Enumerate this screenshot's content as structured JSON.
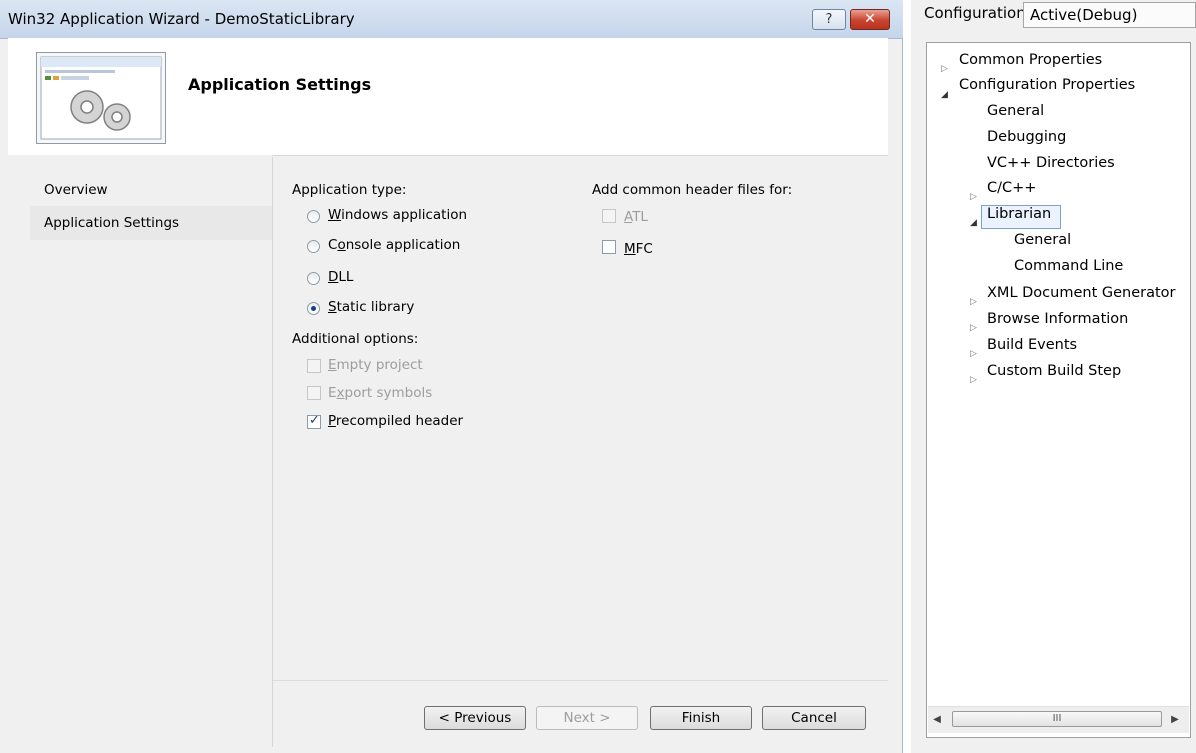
{
  "wizard": {
    "title": "Win32 Application Wizard - DemoStaticLibrary",
    "banner_title": "Application Settings",
    "nav": [
      {
        "label": "Overview"
      },
      {
        "label": "Application Settings"
      }
    ],
    "application_type": {
      "label": "Application type:",
      "options": [
        {
          "text_before": "",
          "mnemonic": "W",
          "text_after": "indows application",
          "selected": false
        },
        {
          "text_before": "C",
          "mnemonic": "o",
          "text_after": "nsole application",
          "selected": false
        },
        {
          "text_before": "",
          "mnemonic": "D",
          "text_after": "LL",
          "selected": false
        },
        {
          "text_before": "",
          "mnemonic": "S",
          "text_after": "tatic library",
          "selected": true
        }
      ]
    },
    "additional_options": {
      "label": "Additional options:",
      "options": [
        {
          "text_before": "",
          "mnemonic": "E",
          "text_after": "mpty project",
          "checked": false,
          "enabled": false
        },
        {
          "text_before": "E",
          "mnemonic": "x",
          "text_after": "port symbols",
          "checked": false,
          "enabled": false
        },
        {
          "text_before": "",
          "mnemonic": "P",
          "text_after": "recompiled header",
          "checked": true,
          "enabled": true
        }
      ]
    },
    "common_headers": {
      "label": "Add common header files for:",
      "options": [
        {
          "text_before": "",
          "mnemonic": "A",
          "text_after": "TL",
          "checked": false,
          "enabled": false
        },
        {
          "text_before": "",
          "mnemonic": "M",
          "text_after": "FC",
          "checked": false,
          "enabled": true
        }
      ]
    },
    "buttons": {
      "previous": "< Previous",
      "next": "Next >",
      "finish": "Finish",
      "cancel": "Cancel"
    },
    "title_buttons": {
      "help": "?",
      "close": "✕"
    }
  },
  "properties": {
    "config_label": "Configuration:",
    "config_value": "Active(Debug)",
    "tree": [
      {
        "label": "Common Properties",
        "expanded": false
      },
      {
        "label": "Configuration Properties",
        "expanded": true
      },
      {
        "label": "General"
      },
      {
        "label": "Debugging"
      },
      {
        "label": "VC++ Directories"
      },
      {
        "label": "C/C++",
        "expanded": false
      },
      {
        "label": "Librarian",
        "expanded": true,
        "selected": true
      },
      {
        "label": "General"
      },
      {
        "label": "Command Line"
      },
      {
        "label": "XML Document Generator",
        "expanded": false
      },
      {
        "label": "Browse Information",
        "expanded": false
      },
      {
        "label": "Build Events",
        "expanded": false
      },
      {
        "label": "Custom Build Step",
        "expanded": false
      }
    ],
    "scroll_thumb_glyph": "III"
  }
}
